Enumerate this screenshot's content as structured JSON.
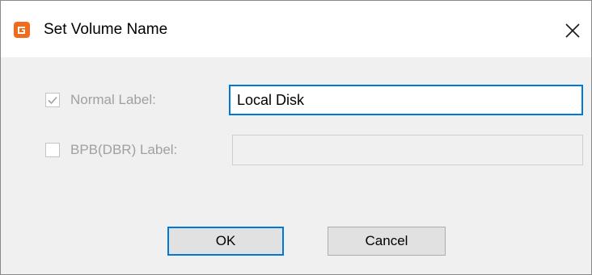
{
  "window": {
    "title": "Set Volume Name",
    "app_icon": "app-logo-icon",
    "close_icon": "close-icon"
  },
  "normal_label": {
    "label": "Normal Label:",
    "checked": true,
    "enabled": false,
    "value": "Local Disk"
  },
  "bpb_label": {
    "label": "BPB(DBR) Label:",
    "checked": false,
    "enabled": false,
    "value": ""
  },
  "buttons": {
    "ok": "OK",
    "cancel": "Cancel"
  },
  "colors": {
    "accent": "#0078d7",
    "app_icon": "#f26b1d",
    "disabled_text": "#a0a0a0",
    "dialog_bg": "#f0f0f0"
  }
}
